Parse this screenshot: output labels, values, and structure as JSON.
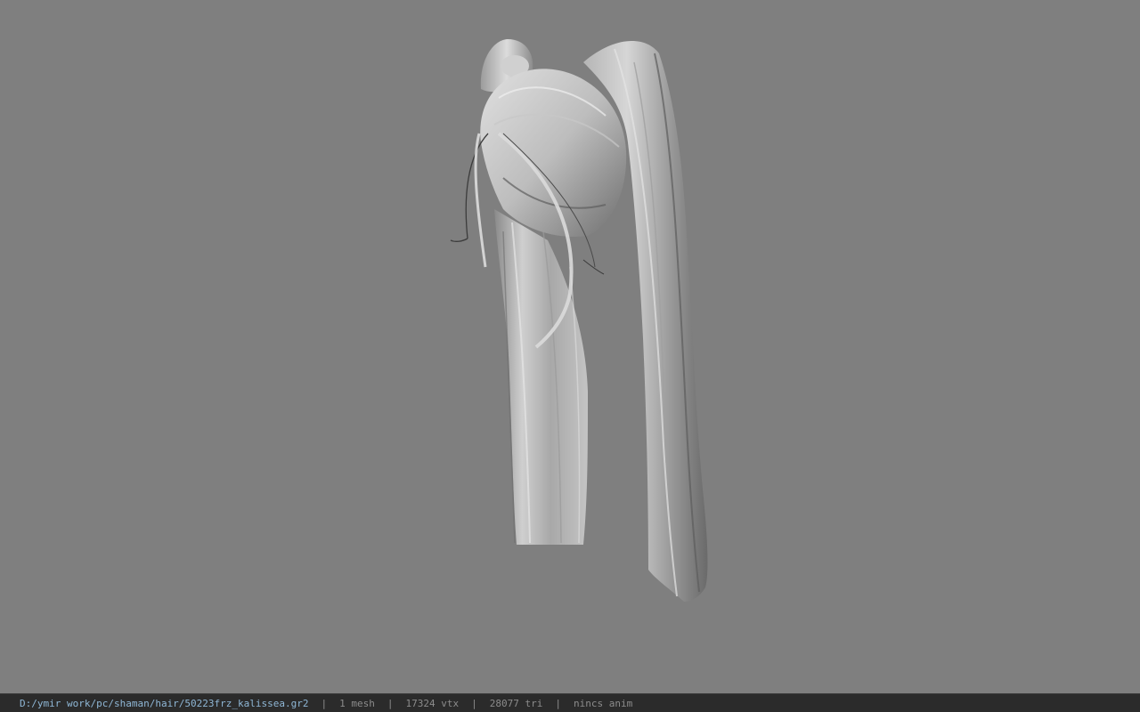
{
  "viewport": {
    "background_color": "#7f7f7f",
    "model_description_icon": "hair-model-icon",
    "model_shade_light": "#d8d8d8",
    "model_shade_dark": "#5a5a5a"
  },
  "status_bar": {
    "background_color": "#2b2b2b",
    "path_color": "#8fb7d6",
    "file_path": "D:/ymir work/pc/shaman/hair/50223frz_kalissea.gr2",
    "separator": "|",
    "mesh_count": "1 mesh",
    "vertex_count": "17324 vtx",
    "triangle_count": "28077 tri",
    "anim_status": "nincs anim"
  }
}
